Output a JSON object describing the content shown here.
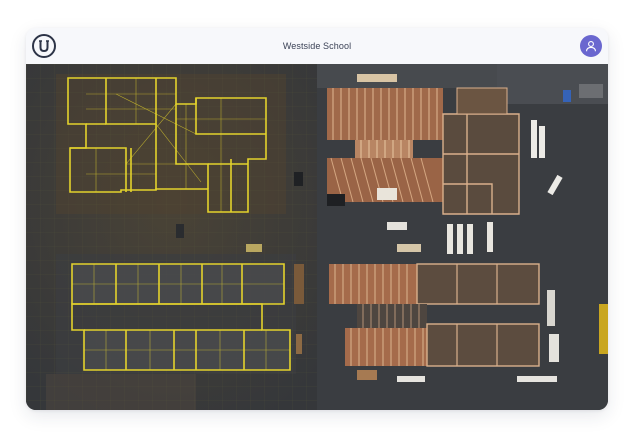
{
  "app": {
    "title": "Westside School",
    "logo_icon": "u-logo-icon",
    "user_icon": "user-icon",
    "accent": "#6a67cf"
  },
  "viewer": {
    "left_pane": "blueprint-overlay",
    "right_pane": "construction-aerial",
    "blueprint_color": "#e3d22c"
  }
}
